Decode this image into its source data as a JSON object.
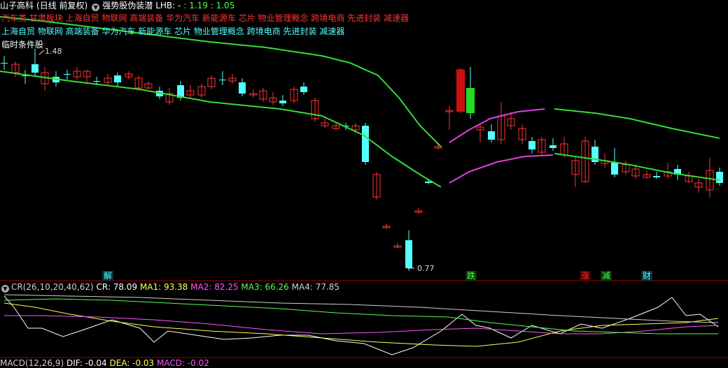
{
  "header": {
    "stock_name": "山子高科",
    "period": "(日线 前复权)",
    "indicator_name": "强势股伪装潜",
    "lhb_label": "LHB: -",
    "lhb_values": ": 1.19 : 1.05"
  },
  "concept_line_red": "汽车类 甘肃板块 上海自贸 物联网 高端装备 华为汽车 新能源车 芯片 物业管理概念 跨境电商 先进封装 减速器",
  "concept_line_cyan": "上海自贸 物联网 高端装备 华为汽车 新能源车 芯片 物业管理概念 跨境电商 先进封装 减速器",
  "condition_label": "临时条件股",
  "price_high_label": "1.48",
  "price_low_label": "0.77",
  "event_markers": [
    {
      "text": "解",
      "color": "#54ffff"
    },
    {
      "text": "跌",
      "color": "#55ff55"
    },
    {
      "text": "涨",
      "color": "#ff3333"
    },
    {
      "text": "减",
      "color": "#55ff55"
    },
    {
      "text": "财",
      "color": "#54ffff"
    }
  ],
  "cr_panel": {
    "name": "CR(26,10,20,40,62)",
    "cr": "CR: 78.09",
    "ma1": "MA1: 93.38",
    "ma2": "MA2: 82.25",
    "ma3": "MA3: 66.26",
    "ma4": "MA4: 77.85"
  },
  "macd_panel": {
    "name": "MACD(12,26,9)",
    "dif": "DIF: -0.04",
    "dea": "DEA: -0.03",
    "macd": "MACD: -0.02"
  },
  "colors": {
    "up": "#ff3333",
    "down": "#54ffff",
    "band": "#33dd33",
    "ma_magenta": "#e040e0",
    "cr": "#ffffff",
    "ma1": "#ffff55",
    "ma2": "#ff55ff",
    "ma3": "#55ff55",
    "ma4": "#cfcfcf"
  }
}
